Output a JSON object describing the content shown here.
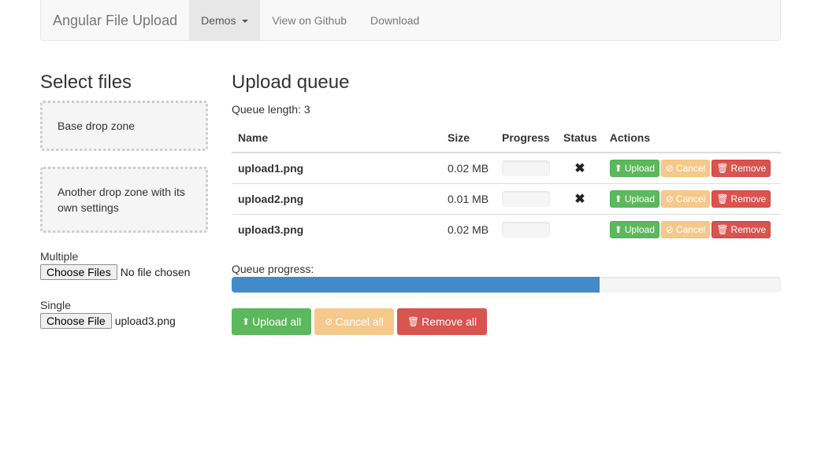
{
  "navbar": {
    "brand": "Angular File Upload",
    "items": [
      {
        "label": "Demos",
        "active": true
      },
      {
        "label": "View on Github"
      },
      {
        "label": "Download"
      }
    ]
  },
  "left": {
    "title": "Select files",
    "dropzone1": "Base drop zone",
    "dropzone2": "Another drop zone with its own settings",
    "multiple_label": "Multiple",
    "multiple_button": "Choose Files",
    "multiple_status": "No file chosen",
    "single_label": "Single",
    "single_button": "Choose File",
    "single_status": "upload3.png"
  },
  "queue": {
    "title": "Upload queue",
    "length_text": "Queue length: 3",
    "columns": [
      "Name",
      "Size",
      "Progress",
      "Status",
      "Actions"
    ],
    "rows": [
      {
        "name": "upload1.png",
        "size": "0.02 MB",
        "status": "✖"
      },
      {
        "name": "upload2.png",
        "size": "0.01 MB",
        "status": "✖"
      },
      {
        "name": "upload3.png",
        "size": "0.02 MB",
        "status": ""
      }
    ],
    "row_actions": {
      "upload": "Upload",
      "cancel": "Cancel",
      "remove": "Remove"
    },
    "progress_label": "Queue progress:",
    "progress_fraction": 0.67,
    "bulk": {
      "upload_all": "Upload all",
      "cancel_all": "Cancel all",
      "remove_all": "Remove all"
    }
  },
  "colors": {
    "success": "#5cb85c",
    "warning": "#f0ad4e",
    "danger": "#d9534f",
    "primary": "#428bca"
  }
}
